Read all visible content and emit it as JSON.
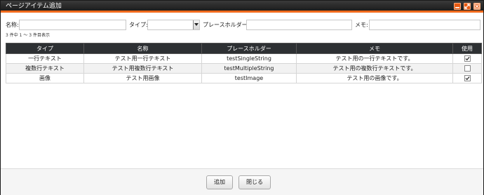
{
  "dialog": {
    "title": "ページアイテム追加"
  },
  "filters": {
    "name_label": "名称:",
    "name_value": "",
    "type_label": "タイプ:",
    "type_value": "",
    "placeholder_label": "プレースホルダー:",
    "placeholder_value": "",
    "memo_label": "メモ:",
    "memo_value": ""
  },
  "count_text": "3 件中 1 ～ 3 件目表示",
  "table": {
    "headers": [
      "タイプ",
      "名称",
      "プレースホルダー",
      "メモ",
      "使用"
    ],
    "rows": [
      {
        "type": "一行テキスト",
        "name": "テスト用一行テキスト",
        "placeholder": "testSingleString",
        "memo": "テスト用の一行テキストです。",
        "used": true
      },
      {
        "type": "複数行テキスト",
        "name": "テスト用複数行テキスト",
        "placeholder": "testMultipleString",
        "memo": "テスト用の複数行テキストです。",
        "used": false
      },
      {
        "type": "画像",
        "name": "テスト用画像",
        "placeholder": "testImage",
        "memo": "テスト用の画像です。",
        "used": true
      }
    ]
  },
  "footer": {
    "add_label": "追加",
    "close_label": "閉じる"
  }
}
